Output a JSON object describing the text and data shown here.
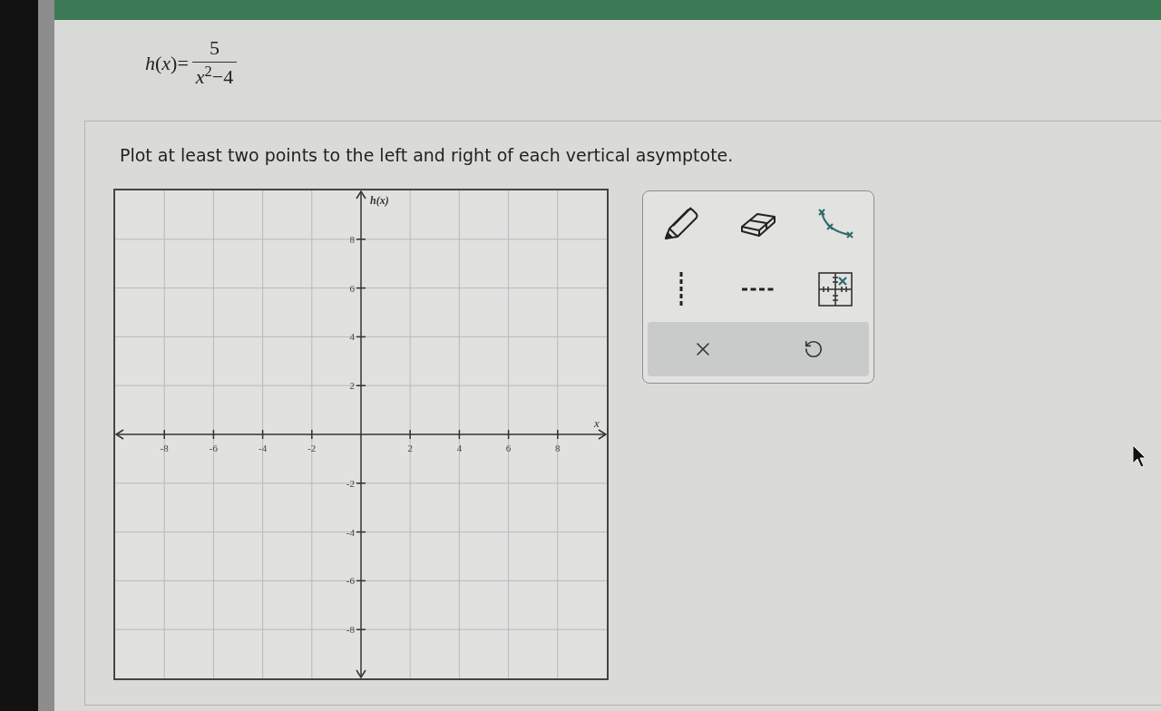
{
  "problem": {
    "formula": {
      "lhs": "*h*(*x*)=",
      "numerator": "5",
      "denominator": "*x*$^{2}$−4"
    }
  },
  "question": {
    "instruction": "Plot at least two points to the left and right of each vertical asymptote.",
    "graph": {
      "chart_data": [
        {
          "type": "scatter",
          "xlabel": "x",
          "ylabel": "h(x)",
          "xlim": [
            -10,
            10
          ],
          "ylim": [
            -10,
            10
          ],
          "xticks": [
            -8,
            -6,
            -4,
            -2,
            2,
            4,
            6,
            8
          ],
          "yticks": [
            -8,
            -6,
            -4,
            -2,
            2,
            4,
            6,
            8
          ],
          "grid": true
        }
      ]
    }
  }
}
